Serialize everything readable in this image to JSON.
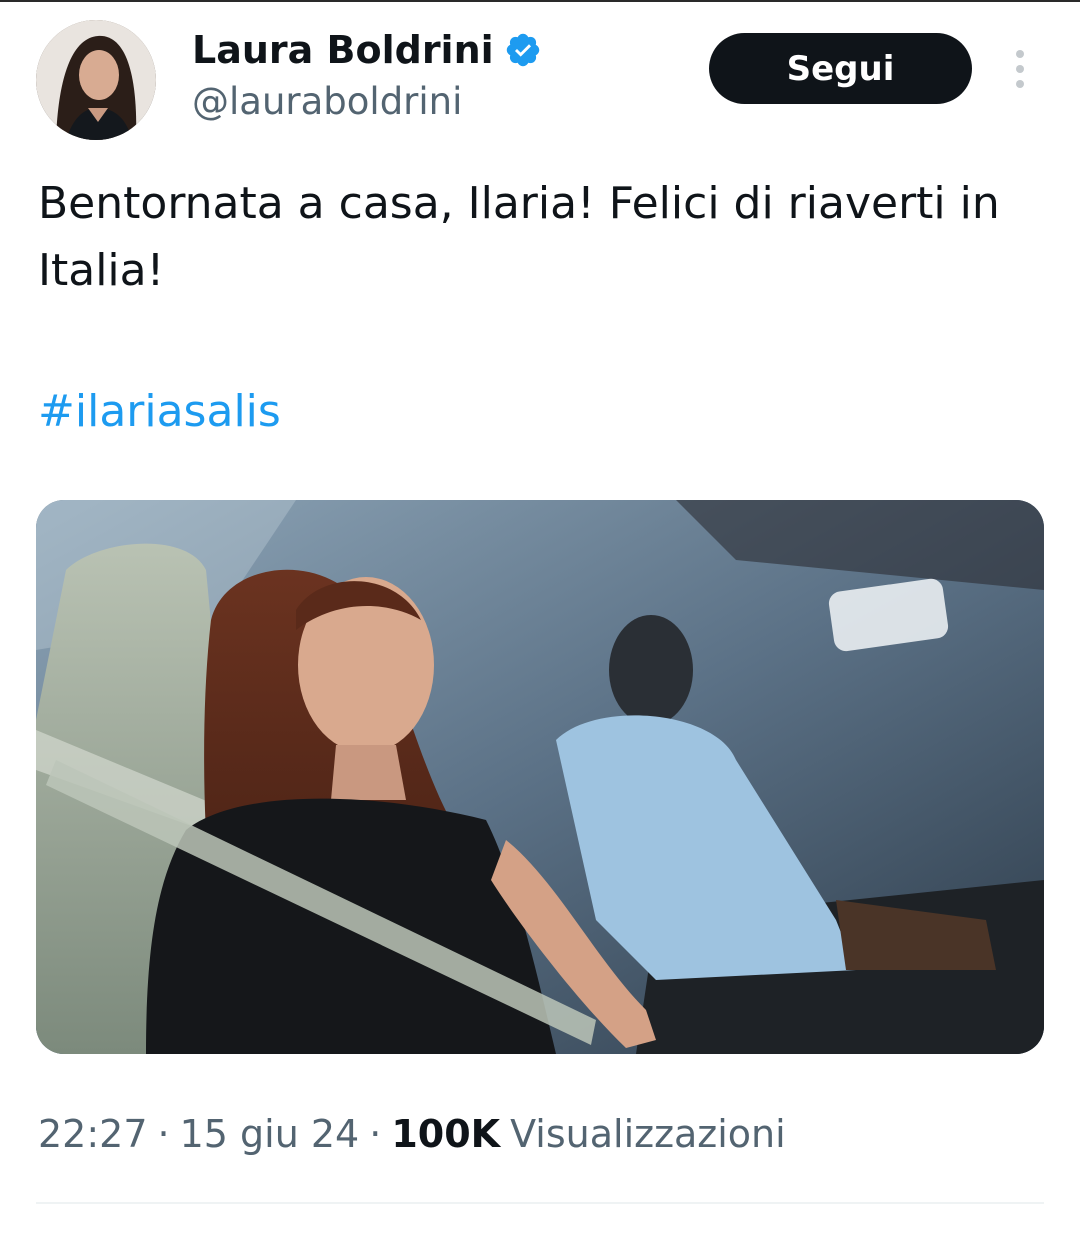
{
  "author": {
    "name": "Laura Boldrini",
    "handle": "@lauraboldrini",
    "verified_icon": "verified-badge-icon",
    "verified_color": "#1d9bf0"
  },
  "actions": {
    "follow_label": "Segui",
    "more_icon": "more-vertical-icon"
  },
  "tweet": {
    "text": "Bentornata a casa, Ilaria! Felici di riaverti in Italia!",
    "hashtag": "#ilariasalis",
    "hashtag_color": "#1d9bf0"
  },
  "meta": {
    "time": "22:27",
    "date": "15 giu 24",
    "views_count": "100K",
    "views_label": "Visualizzazioni",
    "separator": "·"
  },
  "colors": {
    "text": "#0f1419",
    "secondary": "#536471",
    "button_bg": "#0f1419",
    "button_text": "#ffffff"
  }
}
